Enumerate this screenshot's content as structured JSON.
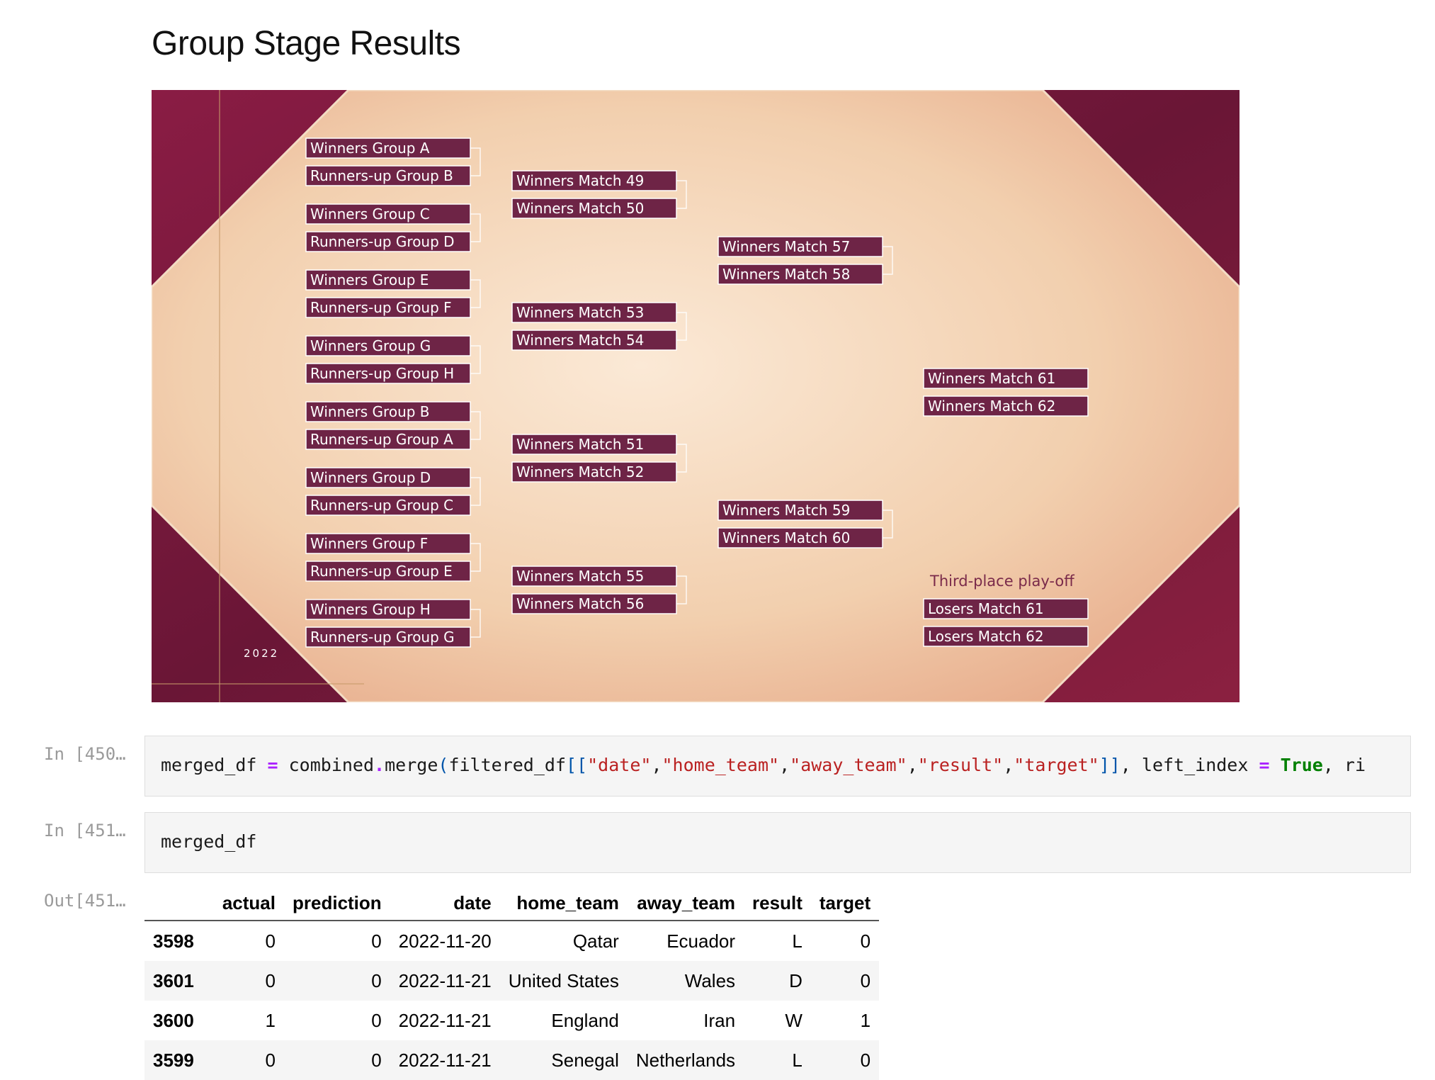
{
  "markdown": {
    "heading": "Group Stage Results"
  },
  "bracket_image": {
    "year_text": "2022",
    "colors": {
      "burgundy": "#7a1a3e",
      "sand": "#f1cfae",
      "label_bg": "#6e2446",
      "line": "#ffffff"
    },
    "round_of_16": [
      "Winners Group A",
      "Runners-up Group B",
      "Winners Group C",
      "Runners-up Group D",
      "Winners Group E",
      "Runners-up Group F",
      "Winners Group G",
      "Runners-up Group H",
      "Winners Group B",
      "Runners-up Group A",
      "Winners Group D",
      "Runners-up Group C",
      "Winners Group F",
      "Runners-up Group E",
      "Winners Group H",
      "Runners-up Group G"
    ],
    "quarter_finals": [
      "Winners Match 49",
      "Winners Match 50",
      "Winners Match 53",
      "Winners Match 54",
      "Winners Match 51",
      "Winners Match 52",
      "Winners Match 55",
      "Winners Match 56"
    ],
    "semi_finals": [
      "Winners Match 57",
      "Winners Match 58",
      "Winners Match 59",
      "Winners Match 60"
    ],
    "final": [
      "Winners Match 61",
      "Winners Match 62"
    ],
    "third_place_title": "Third-place play-off",
    "third_place": [
      "Losers Match 61",
      "Losers Match 62"
    ]
  },
  "cells": [
    {
      "prompt": "In [450…",
      "code_tokens": [
        {
          "t": "merged_df ",
          "c": ""
        },
        {
          "t": "=",
          "c": "op"
        },
        {
          "t": " combined",
          "c": ""
        },
        {
          "t": ".",
          "c": "op"
        },
        {
          "t": "merge",
          "c": ""
        },
        {
          "t": "(",
          "c": "br"
        },
        {
          "t": "filtered_df",
          "c": ""
        },
        {
          "t": "[[",
          "c": "br"
        },
        {
          "t": "\"date\"",
          "c": "str"
        },
        {
          "t": ",",
          "c": ""
        },
        {
          "t": "\"home_team\"",
          "c": "str"
        },
        {
          "t": ",",
          "c": ""
        },
        {
          "t": "\"away_team\"",
          "c": "str"
        },
        {
          "t": ",",
          "c": ""
        },
        {
          "t": "\"result\"",
          "c": "str"
        },
        {
          "t": ",",
          "c": ""
        },
        {
          "t": "\"target\"",
          "c": "str"
        },
        {
          "t": "]]",
          "c": "br"
        },
        {
          "t": ", left_index ",
          "c": ""
        },
        {
          "t": "=",
          "c": "op"
        },
        {
          "t": " ",
          "c": ""
        },
        {
          "t": "True",
          "c": "kw"
        },
        {
          "t": ", ri",
          "c": ""
        }
      ]
    },
    {
      "prompt": "In [451…",
      "code_tokens": [
        {
          "t": "merged_df",
          "c": ""
        }
      ]
    }
  ],
  "output": {
    "prompt": "Out[451…",
    "columns": [
      "",
      "actual",
      "prediction",
      "date",
      "home_team",
      "away_team",
      "result",
      "target"
    ],
    "rows": [
      {
        "index": "3598",
        "values": [
          "0",
          "0",
          "2022-11-20",
          "Qatar",
          "Ecuador",
          "L",
          "0"
        ]
      },
      {
        "index": "3601",
        "values": [
          "0",
          "0",
          "2022-11-21",
          "United States",
          "Wales",
          "D",
          "0"
        ]
      },
      {
        "index": "3600",
        "values": [
          "1",
          "0",
          "2022-11-21",
          "England",
          "Iran",
          "W",
          "1"
        ]
      },
      {
        "index": "3599",
        "values": [
          "0",
          "0",
          "2022-11-21",
          "Senegal",
          "Netherlands",
          "L",
          "0"
        ]
      }
    ]
  }
}
